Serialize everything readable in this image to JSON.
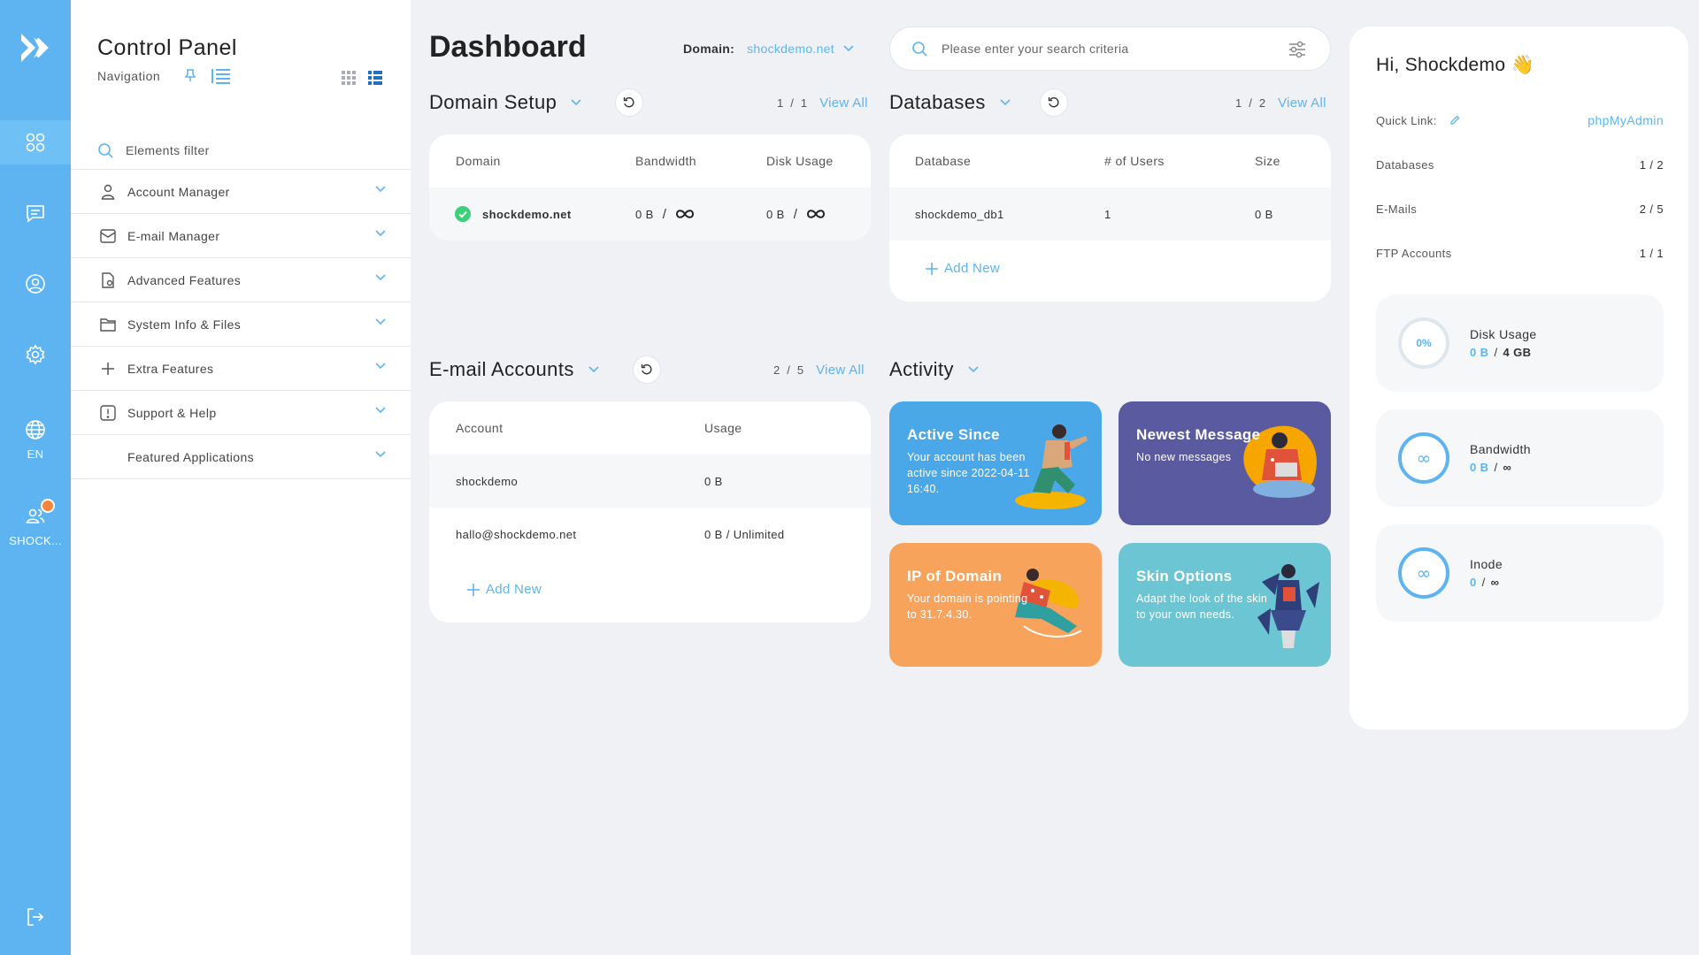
{
  "rail": {
    "lang": "EN",
    "user_short": "SHOCK..."
  },
  "nav": {
    "title": "Control Panel",
    "subtitle": "Navigation",
    "filter_placeholder": "Elements filter",
    "items": [
      {
        "label": "Account Manager",
        "icon": "user-icon"
      },
      {
        "label": "E-mail Manager",
        "icon": "mail-icon"
      },
      {
        "label": "Advanced Features",
        "icon": "document-gear-icon"
      },
      {
        "label": "System Info & Files",
        "icon": "folder-icon"
      },
      {
        "label": "Extra Features",
        "icon": "plus-icon"
      },
      {
        "label": "Support & Help",
        "icon": "alert-icon"
      },
      {
        "label": "Featured Applications",
        "icon": ""
      }
    ]
  },
  "header": {
    "title": "Dashboard",
    "domain_label": "Domain:",
    "domain_value": "shockdemo.net",
    "search_placeholder": "Please enter your search criteria"
  },
  "domain_setup": {
    "title": "Domain Setup",
    "page": "1",
    "sep": "/",
    "total": "1",
    "view_all": "View All",
    "columns": [
      "Domain",
      "Bandwidth",
      "Disk Usage"
    ],
    "rows": [
      {
        "domain": "shockdemo.net",
        "bandwidth_used": "0 B",
        "bandwidth_sep": "/",
        "disk_used": "0 B",
        "disk_sep": "/"
      }
    ]
  },
  "databases": {
    "title": "Databases",
    "page": "1",
    "sep": "/",
    "total": "2",
    "view_all": "View All",
    "columns": [
      "Database",
      "# of Users",
      "Size"
    ],
    "rows": [
      {
        "name": "shockdemo_db1",
        "users": "1",
        "size": "0 B"
      }
    ],
    "add_new": "Add New"
  },
  "email_accounts": {
    "title": "E-mail Accounts",
    "page": "2",
    "sep": "/",
    "total": "5",
    "view_all": "View All",
    "columns": [
      "Account",
      "Usage"
    ],
    "rows": [
      {
        "account": "shockdemo",
        "usage": "0 B"
      },
      {
        "account": "hallo@shockdemo.net",
        "usage": "0 B / Unlimited"
      }
    ],
    "add_new": "Add New"
  },
  "activity": {
    "title": "Activity",
    "tiles": [
      {
        "title": "Active Since",
        "text": "Your account has been active since 2022-04-11 16:40.",
        "color": "#4aa8e8"
      },
      {
        "title": "Newest Message",
        "text": "No new messages",
        "color": "#5a5aa0"
      },
      {
        "title": "IP of Domain",
        "text": "Your domain is pointing to 31.7.4.30.",
        "color": "#f7a35c"
      },
      {
        "title": "Skin Options",
        "text": "Adapt the look of the skin to your own needs.",
        "color": "#6bc5d2"
      }
    ]
  },
  "right_panel": {
    "greeting": "Hi, Shockdemo",
    "wave": "👋",
    "quick_link_label": "Quick Link:",
    "quick_link_value": "phpMyAdmin",
    "stats": [
      {
        "label": "Databases",
        "value": "1 / 2"
      },
      {
        "label": "E-Mails",
        "value": "2 / 5"
      },
      {
        "label": "FTP Accounts",
        "value": "1 / 1"
      }
    ],
    "gauges": [
      {
        "label": "Disk Usage",
        "used": "0 B",
        "sep": "/",
        "total": "4 GB",
        "center": "0%"
      },
      {
        "label": "Bandwidth",
        "used": "0 B",
        "sep": "/",
        "total": "∞",
        "center": "∞"
      },
      {
        "label": "Inode",
        "used": "0",
        "sep": "/",
        "total": "∞",
        "center": "∞"
      }
    ]
  },
  "colors": {
    "accent": "#5db4f0",
    "rail": "#5db4f0",
    "notification": "#f5843a",
    "success": "#3ecf7a"
  }
}
